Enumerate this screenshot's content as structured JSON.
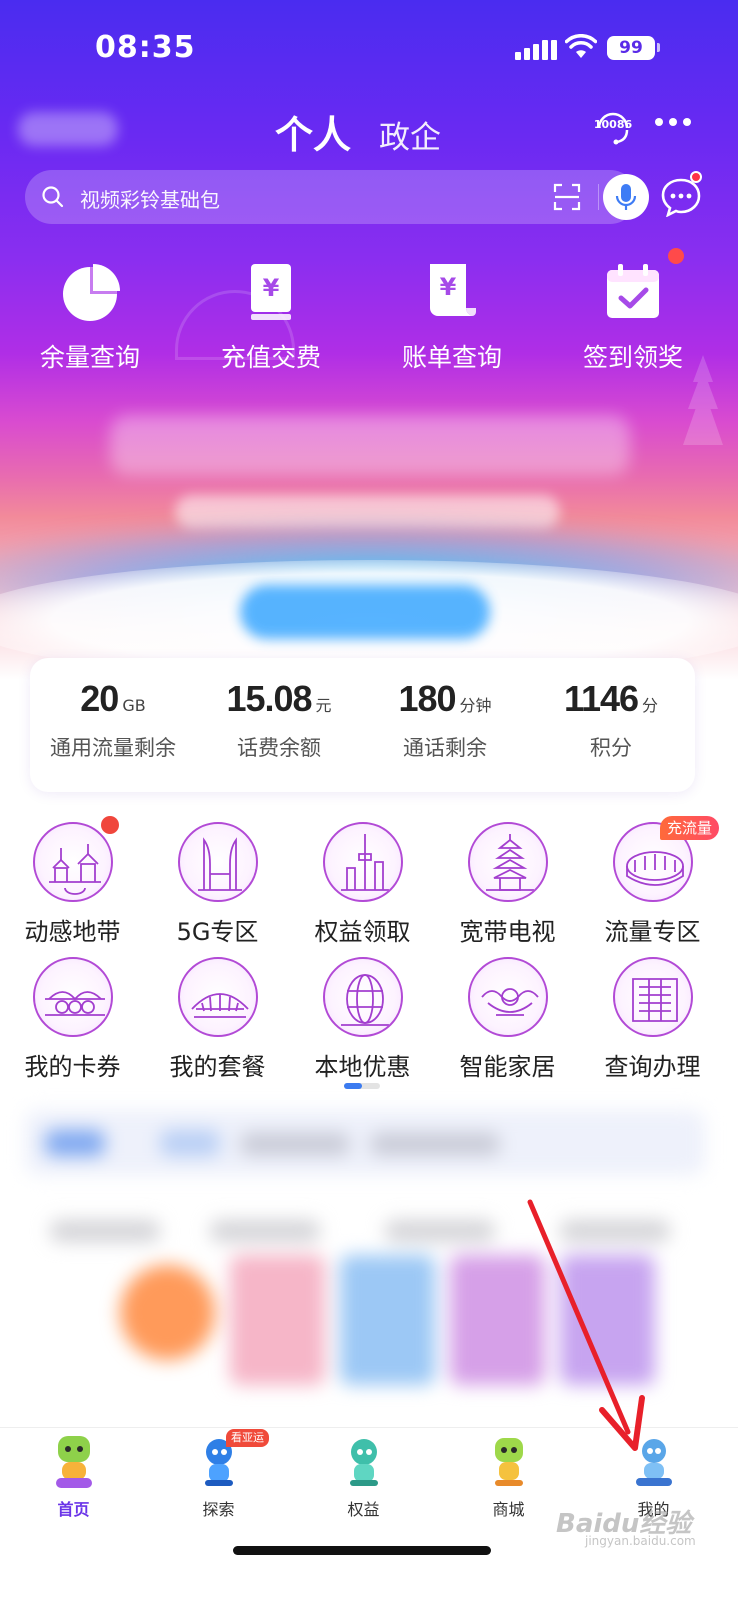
{
  "status_bar": {
    "time": "08:35",
    "battery": "99"
  },
  "header": {
    "tab_active": "个人",
    "tab_other": "政企",
    "service_number": "10086"
  },
  "search": {
    "placeholder": "视频彩铃基础包"
  },
  "quick_actions": [
    {
      "label": "余量查询",
      "icon": "pie-chart-icon"
    },
    {
      "label": "充值交费",
      "icon": "yuan-book-icon"
    },
    {
      "label": "账单查询",
      "icon": "yuan-bill-icon"
    },
    {
      "label": "签到领奖",
      "icon": "calendar-check-icon"
    }
  ],
  "stats": [
    {
      "value": "20",
      "unit": "GB",
      "label": "通用流量剩余"
    },
    {
      "value": "15.08",
      "unit": "元",
      "label": "话费余额"
    },
    {
      "value": "180",
      "unit": "分钟",
      "label": "通话剩余"
    },
    {
      "value": "1146",
      "unit": "分",
      "label": "积分"
    }
  ],
  "services": [
    {
      "label": "动感地带",
      "icon": "pagoda-icon"
    },
    {
      "label": "5G专区",
      "icon": "twin-tower-icon"
    },
    {
      "label": "权益领取",
      "icon": "tv-tower-icon"
    },
    {
      "label": "宽带电视",
      "icon": "leifeng-pagoda-icon"
    },
    {
      "label": "流量专区",
      "icon": "stadium-icon"
    },
    {
      "label": "我的卡券",
      "icon": "bridge-icon"
    },
    {
      "label": "我的套餐",
      "icon": "arena-icon"
    },
    {
      "label": "本地优惠",
      "icon": "globe-building-icon"
    },
    {
      "label": "智能家居",
      "icon": "ornament-icon"
    },
    {
      "label": "查询办理",
      "icon": "museum-icon"
    }
  ],
  "service_badge": "充流量",
  "tabbar": [
    {
      "label": "首页",
      "active": true,
      "icon": "mascot-home-icon"
    },
    {
      "label": "探索",
      "active": false,
      "icon": "mascot-explore-icon"
    },
    {
      "label": "权益",
      "active": false,
      "icon": "mascot-rights-icon"
    },
    {
      "label": "商城",
      "active": false,
      "icon": "mascot-mall-icon"
    },
    {
      "label": "我的",
      "active": false,
      "icon": "mascot-mine-icon"
    }
  ],
  "tab_badge": "看亚运",
  "watermark": {
    "brand": "Baidu经验",
    "url": "jingyan.baidu.com"
  },
  "colors": {
    "accent": "#6a34e8",
    "hero_top": "#4a2cf0",
    "hero_mid": "#b02ee6",
    "badge_red": "#f0463c",
    "annotation_arrow": "#e8202a"
  }
}
